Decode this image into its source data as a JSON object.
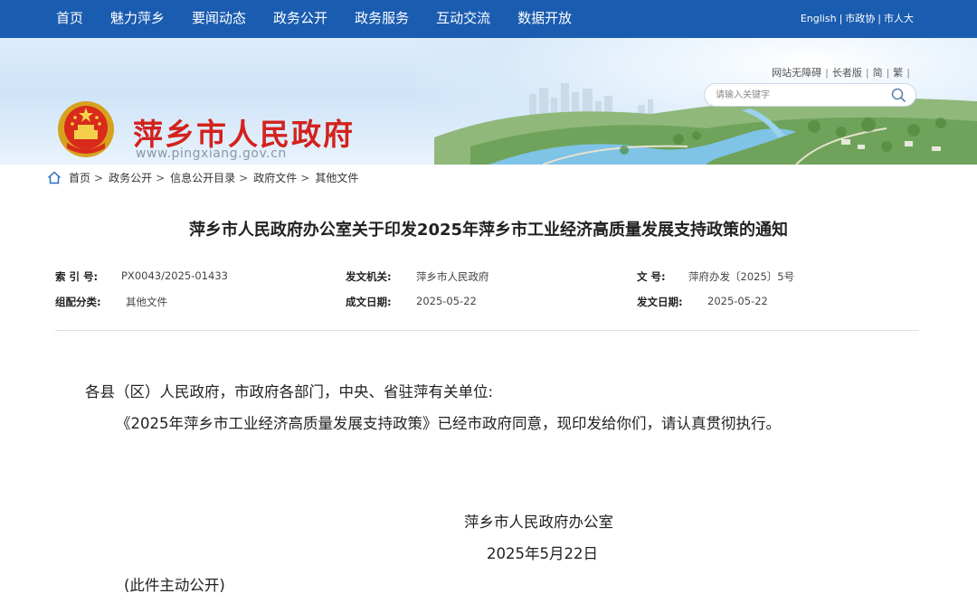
{
  "nav": {
    "items": [
      "首页",
      "魅力萍乡",
      "要闻动态",
      "政务公开",
      "政务服务",
      "互动交流",
      "数据开放"
    ],
    "links": [
      "English",
      "市政协",
      "市人大"
    ]
  },
  "header": {
    "site_title": "萍乡市人民政府",
    "site_url": "www.pingxiang.gov.cn",
    "tools": [
      "网站无障碍",
      "长者版",
      "简",
      "繁"
    ],
    "search_placeholder": "请输入关键字"
  },
  "breadcrumb": [
    "首页",
    "政务公开",
    "信息公开目录",
    "政府文件",
    "其他文件"
  ],
  "document": {
    "title": "萍乡市人民政府办公室关于印发2025年萍乡市工业经济高质量发展支持政策的通知",
    "meta": {
      "index_no_label": "索 引 号:",
      "index_no": "PX0043/2025-01433",
      "issuer_label": "发文机关:",
      "issuer": "萍乡市人民政府",
      "doc_no_label": "文 号:",
      "doc_no": "萍府办发〔2025〕5号",
      "category_label": "组配分类:",
      "category": "其他文件",
      "created_label": "成文日期:",
      "created": "2025-05-22",
      "published_label": "发文日期:",
      "published": "2025-05-22"
    },
    "salutation": "各县（区）人民政府，市政府各部门，中央、省驻萍有关单位:",
    "body": "《2025年萍乡市工业经济高质量发展支持政策》已经市政府同意，现印发给你们，请认真贯彻执行。",
    "signature": "萍乡市人民政府办公室",
    "date": "2025年5月22日",
    "note": "(此件主动公开)"
  },
  "colors": {
    "nav_bg": "#1a5cb0",
    "title_red": "#d3221e"
  }
}
